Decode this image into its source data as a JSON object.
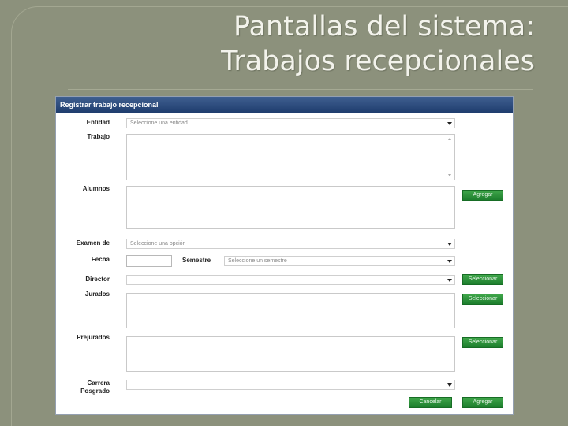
{
  "slide": {
    "title_line1": "Pantallas del sistema:",
    "title_line2": "Trabajos recepcionales"
  },
  "form": {
    "header": "Registrar trabajo recepcional",
    "labels": {
      "entidad": "Entidad",
      "trabajo": "Trabajo",
      "alumnos": "Alumnos",
      "examen": "Examen de",
      "fecha": "Fecha",
      "semestre": "Semestre",
      "director": "Director",
      "jurados": "Jurados",
      "prejurados": "Prejurados",
      "carrera_line1": "Carrera",
      "carrera_line2": "Posgrado"
    },
    "entidad_select": "Seleccione una entidad",
    "examen_select": "Seleccione una opción",
    "semestre_select": "Seleccione un semestre",
    "director_select": "",
    "carrera_select": "",
    "fecha_value": "",
    "buttons": {
      "agregar_alumno": "Agregar",
      "seleccionar_director": "Seleccionar",
      "seleccionar_jurados": "Seleccionar",
      "seleccionar_prejurados": "Seleccionar",
      "cancelar": "Cancelar",
      "agregar": "Agregar"
    }
  },
  "colors": {
    "slide_background": "#8c917c",
    "header_blue": "#2a4a7e",
    "button_green": "#2a8f39"
  },
  "icons": [
    "chevron-down-icon",
    "scroll-up-icon",
    "scroll-down-icon"
  ]
}
